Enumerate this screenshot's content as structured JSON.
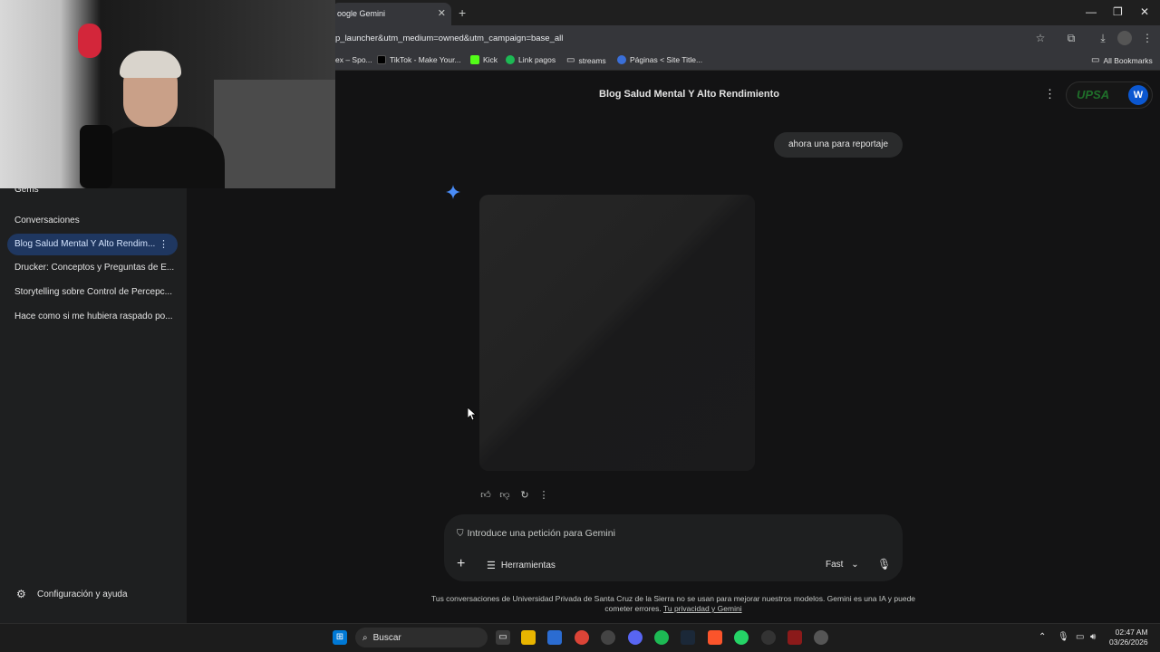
{
  "browser": {
    "tab_title": "oogle Gemini",
    "url": "p_launcher&utm_medium=owned&utm_campaign=base_all",
    "bookmarks": [
      {
        "label": "ex – Spo...",
        "icon": "spotify-icon"
      },
      {
        "label": "TikTok - Make Your...",
        "icon": "tiktok-icon"
      },
      {
        "label": "Kick",
        "icon": "kick-icon"
      },
      {
        "label": "Link pagos",
        "icon": "link-icon"
      },
      {
        "label": "streams",
        "icon": "folder-icon"
      },
      {
        "label": "Páginas < Site Title...",
        "icon": "wordpress-icon"
      }
    ],
    "all_bookmarks": "All Bookmarks"
  },
  "sidebar": {
    "gems_label": "Gems",
    "section_title": "Conversaciones",
    "conversations": [
      {
        "label": "Blog Salud Mental Y Alto Rendim...",
        "active": true
      },
      {
        "label": "Drucker: Conceptos y Preguntas de E...",
        "active": false
      },
      {
        "label": "Storytelling sobre Control de Percepc...",
        "active": false
      },
      {
        "label": "Hace como si me hubiera raspado po...",
        "active": false
      }
    ],
    "settings_label": "Configuración y ayuda"
  },
  "main": {
    "conversation_title": "Blog Salud Mental Y Alto Rendimiento",
    "user_message": "ahora una para reportaje",
    "input_placeholder": "Introduce una petición para Gemini",
    "tools_label": "Herramientas",
    "model_label": "Fast",
    "disclaimer": "Tus conversaciones de Universidad Privada de Santa Cruz de la Sierra no se usan para mejorar nuestros modelos. Gemini es una IA y puede cometer errores.",
    "privacy_link": "Tu privacidad y Gemini",
    "brand": "UPSA",
    "avatar_initial": "W"
  },
  "taskbar": {
    "search_label": "Buscar",
    "time": "02:47 AM",
    "date": "03/26/2026"
  },
  "colors": {
    "background": "#131314",
    "sidebar": "#1e1f20",
    "active_conversation": "#1f3760",
    "accent_blue": "#0b57d0",
    "gemini_star": "#4a8cf7"
  }
}
